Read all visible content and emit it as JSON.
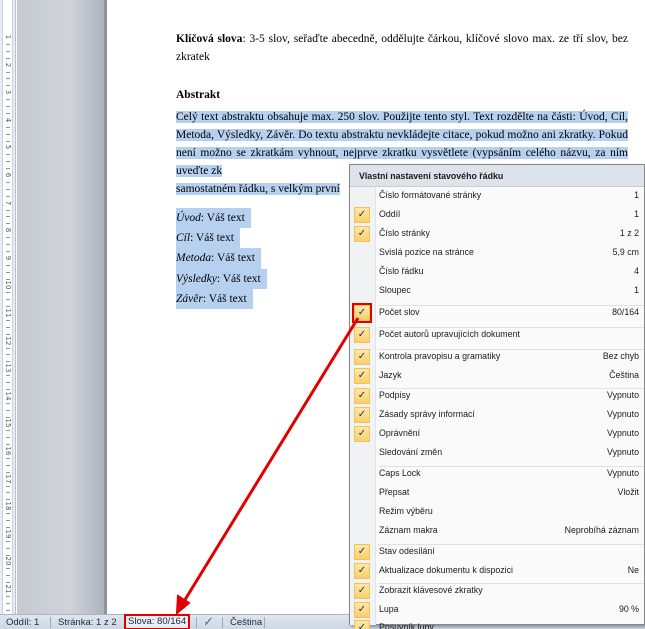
{
  "ruler": {
    "numbers": [
      "1",
      "2",
      "3",
      "4",
      "5",
      "6",
      "7",
      "8",
      "9",
      "10",
      "11",
      "12",
      "13",
      "14",
      "15",
      "16",
      "17",
      "18",
      "19",
      "20",
      "21"
    ]
  },
  "document": {
    "keywords_label": "Klíčová slova",
    "keywords_text": ": 3-5 slov, seřaďte abecedně, oddělujte čárkou, klíčové slovo max. ze tří slov, bez zkratek",
    "abstract_heading": "Abstrakt",
    "abstract_text": "Celý text abstraktu obsahuje max. 250 slov. Použijte tento styl. Text rozdělte na části: Úvod, Cíl, Metoda, Výsledky, Závěr. Do textu abstraktu nevkládejte citace, pokud možno ani zkratky. Pokud není možno se zkratkám vyhnout, nejprve zkratku vysvětlete (vypsáním celého názvu, za ním uveďte zk",
    "abstract_tail": "samostatném řádku, s velkým první",
    "sections": [
      {
        "label": "Úvod",
        "text": ": Váš text"
      },
      {
        "label": "Cíl",
        "text": ": Váš text"
      },
      {
        "label": "Metoda",
        "text": ": Váš text"
      },
      {
        "label": "Výsledky",
        "text": ":  Váš text"
      },
      {
        "label": "Závěr",
        "text": ": Váš text"
      }
    ]
  },
  "statusbar": {
    "section": "Oddíl: 1",
    "page": "Stránka: 1 z 2",
    "words": "Slova: 80/164",
    "language": "Čeština"
  },
  "menu": {
    "title": "Vlastní nastavení stavového řádku",
    "items": [
      {
        "label": "Číslo formátované stránky",
        "value": "1",
        "checked": false
      },
      {
        "label": "Oddíl",
        "value": "1",
        "checked": true
      },
      {
        "label": "Číslo stránky",
        "value": "1 z 2",
        "checked": true
      },
      {
        "label": "Svislá pozice na stránce",
        "value": "5,9 cm",
        "checked": false
      },
      {
        "label": "Číslo řádku",
        "value": "4",
        "checked": false
      },
      {
        "label": "Sloupec",
        "value": "1",
        "checked": false
      },
      {
        "label": "Počet slov",
        "value": "80/164",
        "checked": true
      },
      {
        "label": "Počet autorů upravujících dokument",
        "value": "",
        "checked": true
      },
      {
        "label": "Kontrola pravopisu a gramatiky",
        "value": "Bez chyb",
        "checked": true
      },
      {
        "label": "Jazyk",
        "value": "Čeština",
        "checked": true
      },
      {
        "label": "Podpisy",
        "value": "Vypnuto",
        "checked": true
      },
      {
        "label": "Zásady správy informací",
        "value": "Vypnuto",
        "checked": true
      },
      {
        "label": "Oprávnění",
        "value": "Vypnuto",
        "checked": true
      },
      {
        "label": "Sledování změn",
        "value": "Vypnuto",
        "checked": false
      },
      {
        "label": "Caps Lock",
        "value": "Vypnuto",
        "checked": false
      },
      {
        "label": "Přepsat",
        "value": "Vložit",
        "checked": false
      },
      {
        "label": "Režim výběru",
        "value": "",
        "checked": false
      },
      {
        "label": "Záznam makra",
        "value": "Neprobíhá záznam",
        "checked": false
      },
      {
        "label": "Stav odesílání",
        "value": "",
        "checked": true
      },
      {
        "label": "Aktualizace dokumentu k dispozici",
        "value": "Ne",
        "checked": true
      },
      {
        "label": "Zobrazit klávesové zkratky",
        "value": "",
        "checked": true
      },
      {
        "label": "Lupa",
        "value": "90 %",
        "checked": true
      },
      {
        "label": "Posuvník lupy",
        "value": "",
        "checked": true
      }
    ],
    "checkmark": "✓"
  },
  "colors": {
    "selection": "#b6d0ef",
    "annotation": "#e00000",
    "check_bg": "#f7cf6a"
  }
}
